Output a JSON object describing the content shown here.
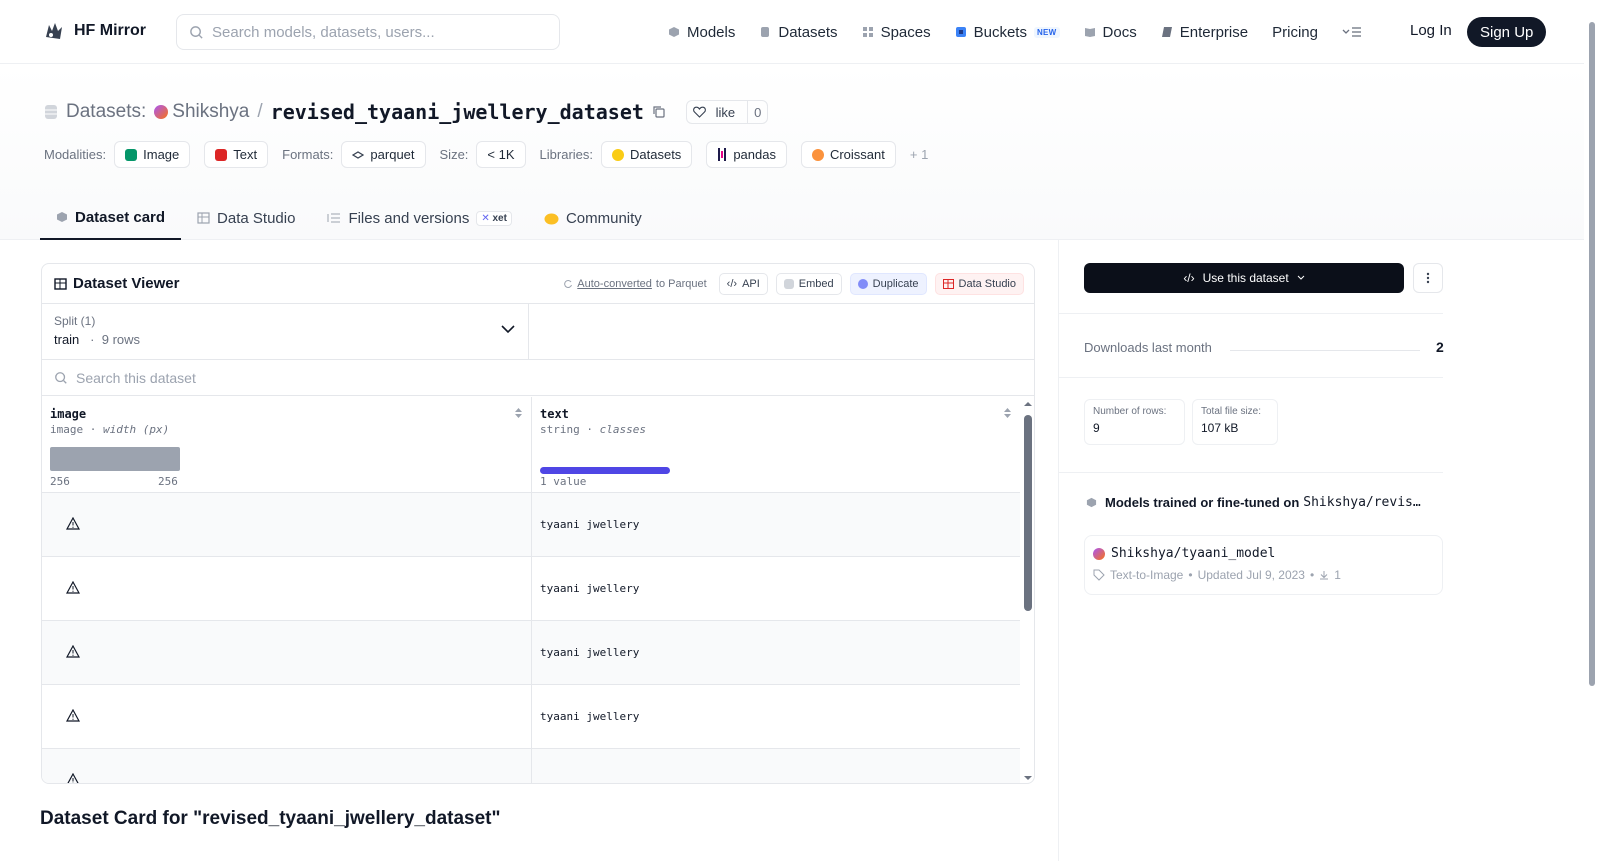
{
  "header": {
    "logo_text": "HF Mirror",
    "search_placeholder": "Search models, datasets, users...",
    "nav": [
      {
        "label": "Models"
      },
      {
        "label": "Datasets"
      },
      {
        "label": "Spaces"
      },
      {
        "label": "Buckets",
        "badge": "NEW"
      },
      {
        "label": "Docs"
      },
      {
        "label": "Enterprise"
      },
      {
        "label": "Pricing"
      }
    ],
    "login": "Log In",
    "signup": "Sign Up"
  },
  "title": {
    "type": "Datasets:",
    "owner": "Shikshya",
    "separator": "/",
    "name": "revised_tyaani_jwellery_dataset",
    "like_label": "like",
    "like_count": "0"
  },
  "tags": {
    "modalities_label": "Modalities:",
    "modalities": [
      "Image",
      "Text"
    ],
    "formats_label": "Formats:",
    "formats": [
      "parquet"
    ],
    "size_label": "Size:",
    "size": "< 1K",
    "libraries_label": "Libraries:",
    "libraries": [
      "Datasets",
      "pandas",
      "Croissant"
    ],
    "more": "+ 1"
  },
  "tabs": [
    {
      "label": "Dataset card",
      "active": true
    },
    {
      "label": "Data Studio"
    },
    {
      "label": "Files and versions",
      "badge": "xet"
    },
    {
      "label": "Community"
    }
  ],
  "viewer": {
    "title": "Dataset Viewer",
    "auto_prefix": "Auto-converted",
    "auto_suffix": "to Parquet",
    "api": "API",
    "embed": "Embed",
    "duplicate": "Duplicate",
    "data_studio": "Data Studio",
    "split_label": "Split (1)",
    "split_value": "train",
    "split_dot": "·",
    "split_rows": "9 rows",
    "search_placeholder": "Search this dataset",
    "columns": [
      {
        "name": "image",
        "type": "image",
        "stat": "width (px)",
        "min": "256",
        "max": "256"
      },
      {
        "name": "text",
        "type": "string",
        "stat": "classes",
        "summary": "1 value"
      }
    ],
    "type_sep": "·",
    "rows": [
      {
        "text": "tyaani jwellery"
      },
      {
        "text": "tyaani jwellery"
      },
      {
        "text": "tyaani jwellery"
      },
      {
        "text": "tyaani jwellery"
      },
      {
        "text": ""
      }
    ]
  },
  "card_title": "Dataset Card for \"revised_tyaani_jwellery_dataset\"",
  "sidebar": {
    "use_button": "Use this dataset",
    "downloads_label": "Downloads last month",
    "downloads_value": "2",
    "rows_label": "Number of rows:",
    "rows_value": "9",
    "size_label": "Total file size:",
    "size_value": "107 kB",
    "models_heading": "Models trained or fine-tuned on",
    "models_heading_repo": "Shikshya/revis…",
    "model": {
      "name": "Shikshya/tyaani_model",
      "task": "Text-to-Image",
      "updated": "Updated Jul 9, 2023",
      "meta_sep": "•",
      "downloads": "1"
    }
  },
  "colors": {
    "accent": "#4f46e5",
    "dark": "#111827",
    "muted": "#6b7280"
  }
}
